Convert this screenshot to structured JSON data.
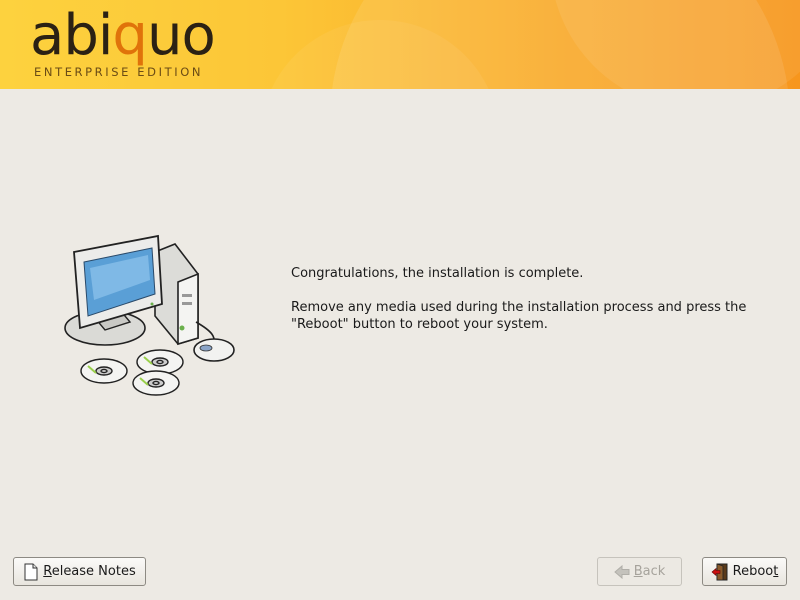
{
  "header": {
    "brand_prefix": "abi",
    "brand_q": "q",
    "brand_suffix": "uo",
    "edition": "ENTERPRISE EDITION"
  },
  "message": {
    "line1": "Congratulations, the installation is complete.",
    "line2": "Remove any media used during the installation process and press the \"Reboot\" button to reboot your system."
  },
  "buttons": {
    "release_notes": {
      "mnemonic": "R",
      "rest": "elease Notes",
      "enabled": true
    },
    "back": {
      "mnemonic": "B",
      "rest": "ack",
      "enabled": false
    },
    "reboot": {
      "prefix": "Reboo",
      "mnemonic": "t",
      "enabled": true
    }
  },
  "colors": {
    "header_start": "#fdd23e",
    "header_end": "#f7961d",
    "background": "#edeae4",
    "brand_text": "#2b2114",
    "brand_accent": "#e0730a"
  },
  "icons": [
    "document-icon",
    "back-arrow-icon",
    "exit-door-icon"
  ]
}
